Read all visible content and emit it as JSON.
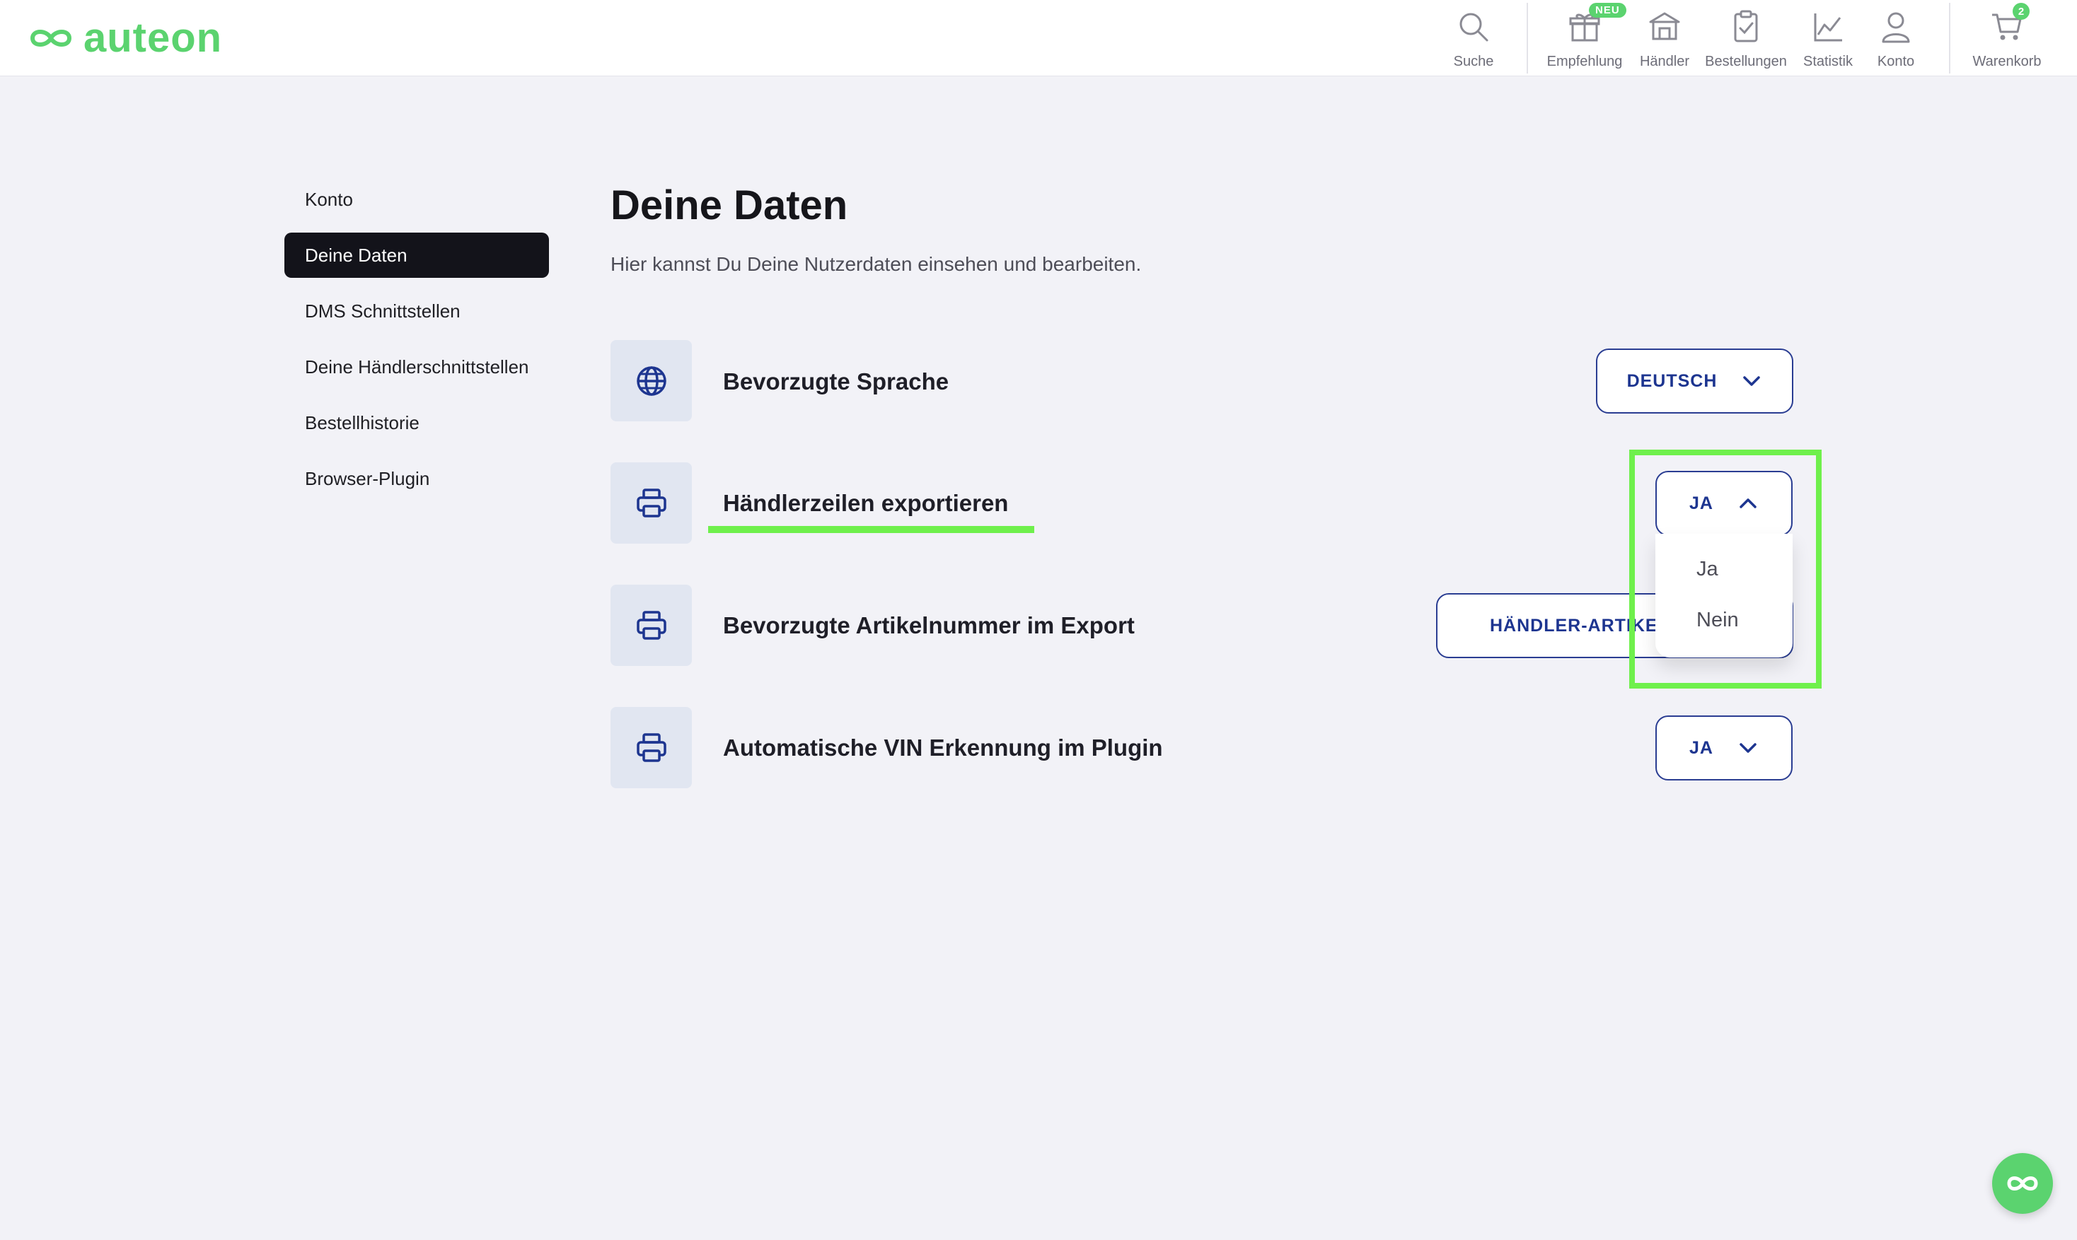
{
  "brand": {
    "name": "auteon",
    "color": "#5bd36f"
  },
  "header": {
    "nav": [
      {
        "label": "Suche",
        "icon": "search-icon"
      },
      {
        "label": "Empfehlung",
        "icon": "gift-icon",
        "badge": "NEU"
      },
      {
        "label": "Händler",
        "icon": "store-icon"
      },
      {
        "label": "Bestellungen",
        "icon": "clipboard-check-icon"
      },
      {
        "label": "Statistik",
        "icon": "line-chart-icon"
      },
      {
        "label": "Konto",
        "icon": "user-icon"
      },
      {
        "label": "Warenkorb",
        "icon": "cart-icon",
        "badge": "2"
      }
    ]
  },
  "sidebar": {
    "items": [
      {
        "label": "Konto",
        "active": false
      },
      {
        "label": "Deine Daten",
        "active": true
      },
      {
        "label": "DMS Schnittstellen",
        "active": false
      },
      {
        "label": "Deine Händlerschnittstellen",
        "active": false
      },
      {
        "label": "Bestellhistorie",
        "active": false
      },
      {
        "label": "Browser-Plugin",
        "active": false
      }
    ]
  },
  "main": {
    "title": "Deine Daten",
    "subtitle": "Hier kannst Du Deine Nutzerdaten einsehen und bearbeiten.",
    "settings": [
      {
        "label": "Bevorzugte Sprache",
        "icon": "globe-icon",
        "value": "DEUTSCH",
        "expanded": false
      },
      {
        "label": "Händlerzeilen exportieren",
        "icon": "printer-icon",
        "value": "JA",
        "expanded": true,
        "options": [
          "Ja",
          "Nein"
        ]
      },
      {
        "label": "Bevorzugte Artikelnummer im Export",
        "icon": "printer-icon",
        "value": "HÄNDLER-ARTIKELNUMMER",
        "expanded": false
      },
      {
        "label": "Automatische VIN Erkennung im Plugin",
        "icon": "printer-icon",
        "value": "JA",
        "expanded": false
      }
    ]
  },
  "colors": {
    "accent": "#1d3590",
    "highlight": "#6ff04c",
    "background": "#f2f2f7"
  }
}
